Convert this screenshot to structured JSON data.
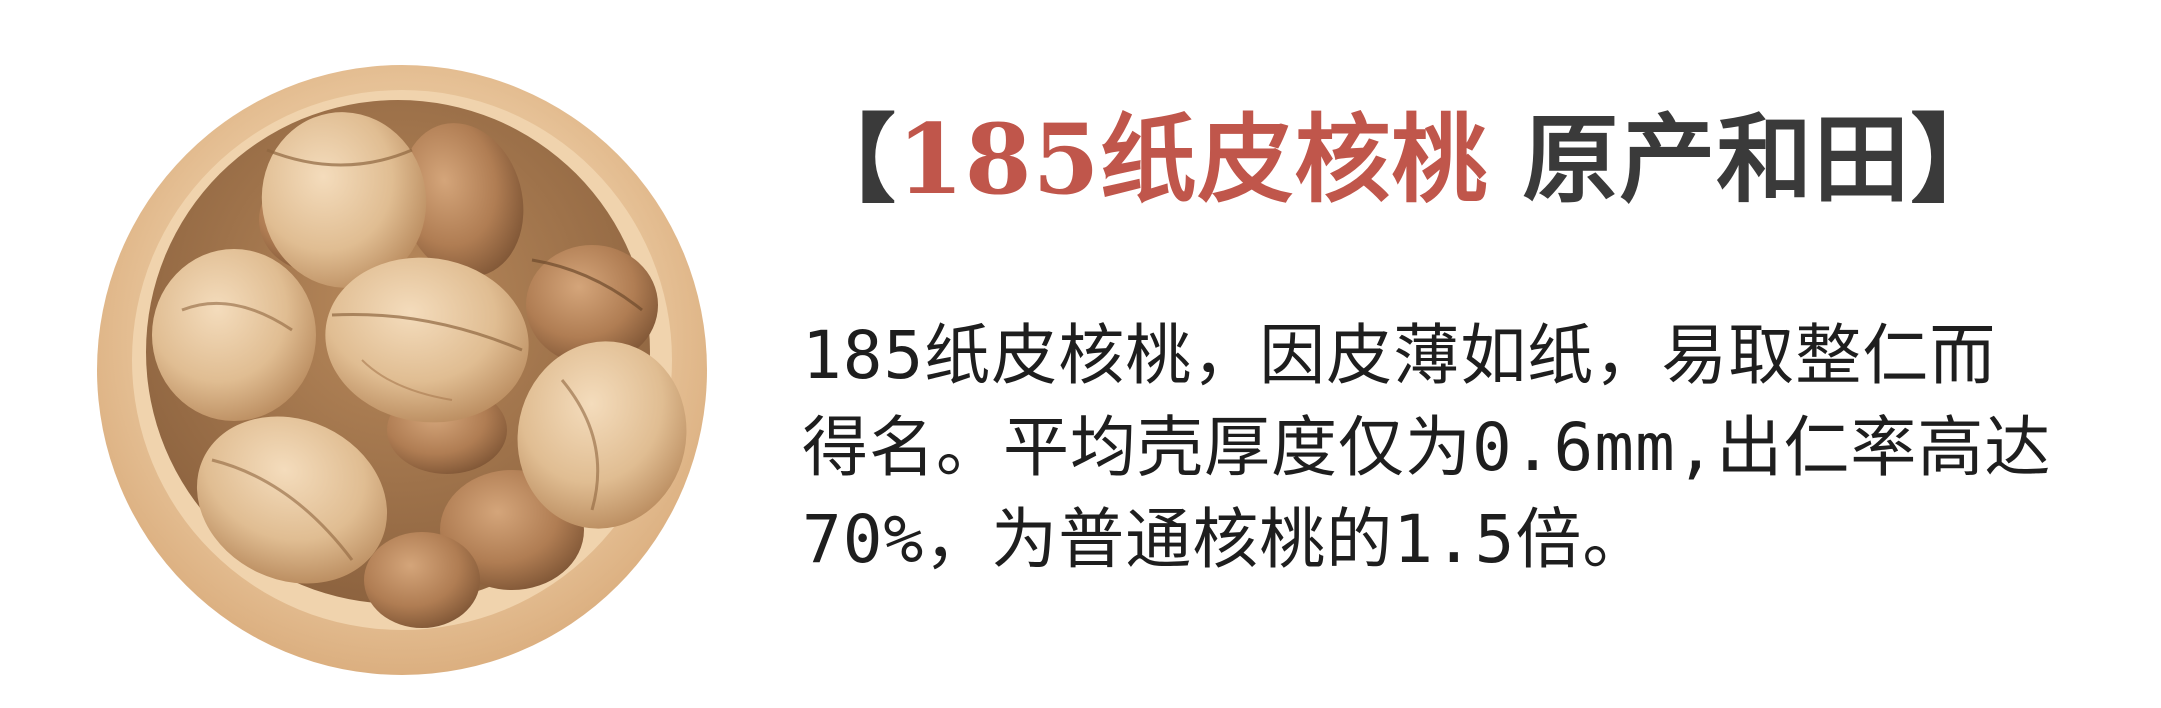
{
  "headline": {
    "bracket_open": "【",
    "accent_text": "185纸皮核桃",
    "dark_text": "原产和田",
    "bracket_close": "】"
  },
  "body": {
    "lines": [
      "185纸皮核桃，因皮薄如纸，易取整仁而",
      "得名。平均壳厚度仅为0.6mm,出仁率高达",
      "70%，为普通核桃的1.5倍。"
    ]
  },
  "colors": {
    "accent": "#c0564b",
    "dark": "#3a3a3a",
    "body_text": "#1e1e1e",
    "bowl_wood": "#e2bd93"
  }
}
